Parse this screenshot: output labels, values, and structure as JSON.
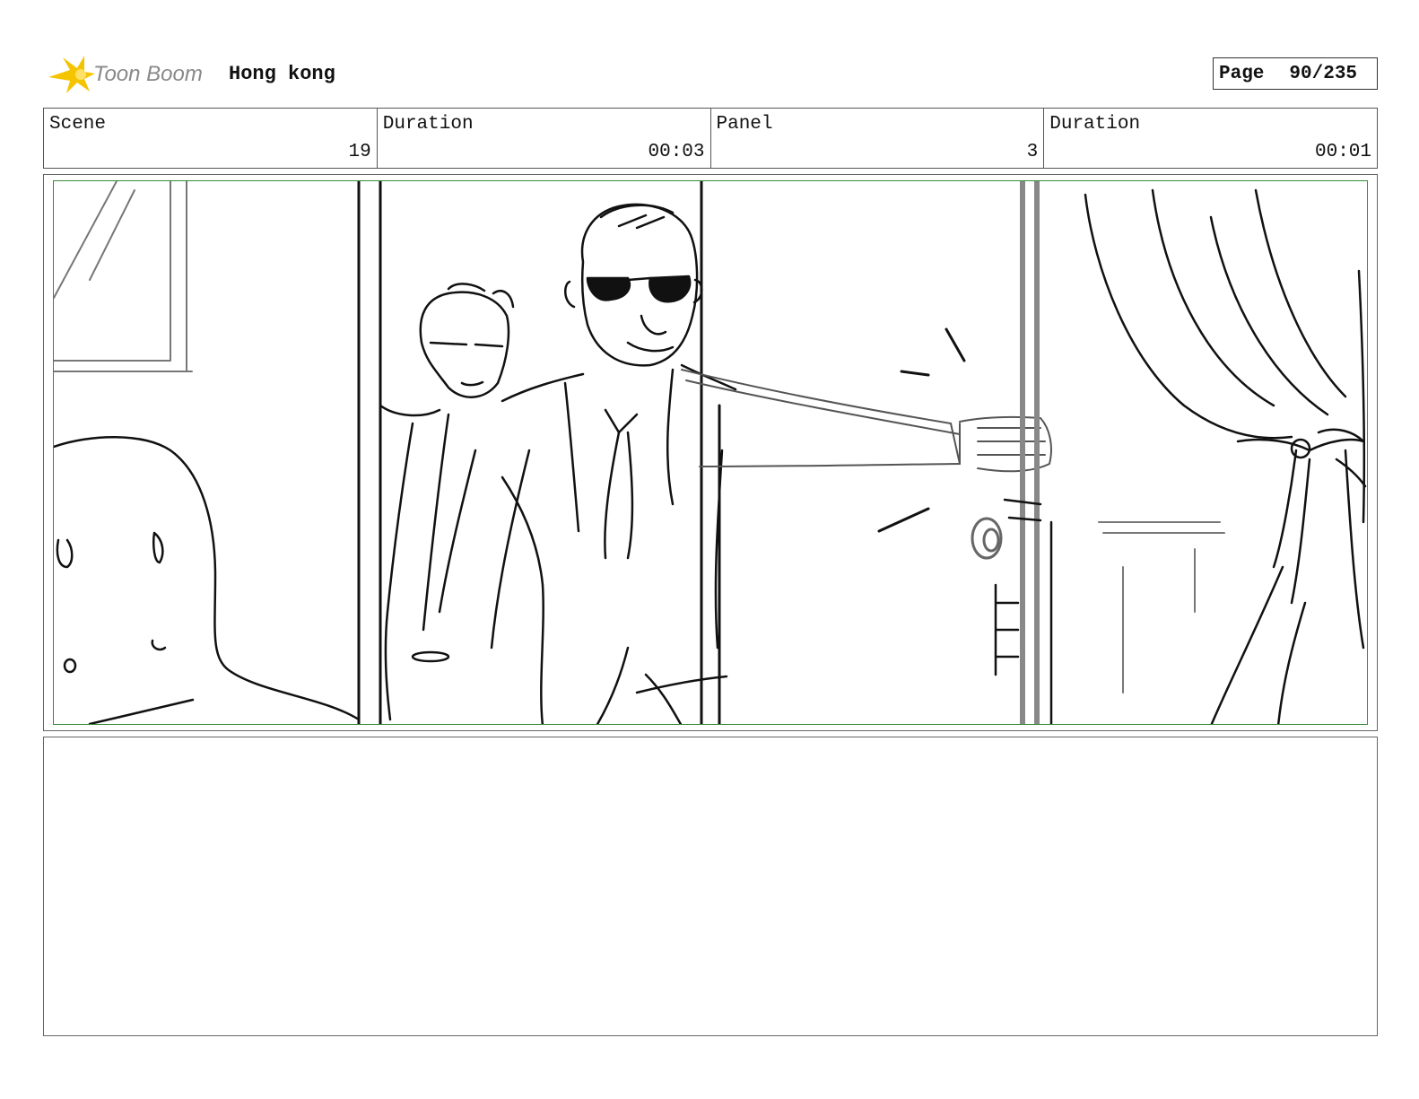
{
  "header": {
    "logo_text": "Toon Boom",
    "project_title": "Hong kong",
    "page_label": "Page",
    "page_number": "90/235"
  },
  "info": {
    "scene_label": "Scene",
    "scene_value": "19",
    "scene_duration_label": "Duration",
    "scene_duration_value": "00:03",
    "panel_label": "Panel",
    "panel_value": "3",
    "panel_duration_label": "Duration",
    "panel_duration_value": "00:01"
  },
  "notes": {
    "text": ""
  },
  "colors": {
    "panel_border": "#3a8a3a",
    "logo_star": "#f5c400",
    "logo_text": "#888888"
  }
}
